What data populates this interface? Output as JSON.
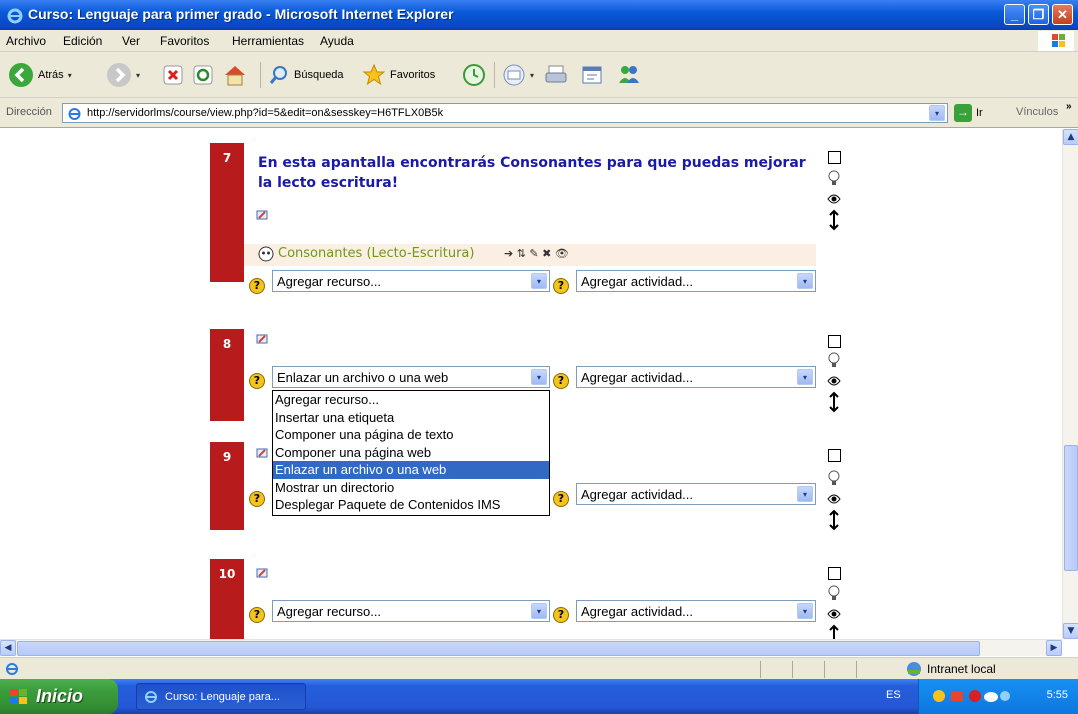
{
  "window": {
    "title": "Curso: Lenguaje para primer grado - Microsoft Internet Explorer",
    "minimize_symbol": "_",
    "restore_symbol": "❐",
    "close_symbol": "✕"
  },
  "menu": [
    "Archivo",
    "Edición",
    "Ver",
    "Favoritos",
    "Herramientas",
    "Ayuda"
  ],
  "toolbar": {
    "back_label": "Atrás",
    "search_label": "Búsqueda",
    "favorites_label": "Favoritos",
    "dropdown_symbol": "▾"
  },
  "address": {
    "label": "Dirección",
    "url": "http://servidorlms/course/view.php?id=5&edit=on&sesskey=H6TFLX0B5k",
    "go_label": "Ir",
    "go_symbol": "→",
    "links_label": "Vínculos",
    "more_symbol": "»"
  },
  "sections": [
    {
      "number": "7",
      "heading": "En esta apantalla encontrarás Consonantes para que puedas mejorar la lecto escritura!",
      "resource_link": "Consonantes (Lecto-Escritura)",
      "resource_tools": "➔ ⇅ ✎ ✖ 👁",
      "resource_select": "Agregar recurso...",
      "activity_select": "Agregar actividad..."
    },
    {
      "number": "8",
      "resource_select": "Enlazar un archivo o una web",
      "activity_select": "Agregar actividad..."
    },
    {
      "number": "9",
      "activity_select": "Agregar actividad..."
    },
    {
      "number": "10",
      "resource_select": "Agregar recurso...",
      "activity_select": "Agregar actividad..."
    }
  ],
  "dropdown_options": [
    "Agregar recurso...",
    "Insertar una etiqueta",
    "Componer una página de texto",
    "Componer una página web",
    "Enlazar un archivo o una web",
    "Mostrar un directorio",
    "Desplegar Paquete de Contenidos IMS"
  ],
  "dropdown_selected_index": 4,
  "help_symbol": "?",
  "select_arrow_symbol": "▾",
  "statusbar": {
    "zone": "Intranet local"
  },
  "taskbar": {
    "start": "Inicio",
    "task": "Curso: Lenguaje para...",
    "language": "ES",
    "clock": "5:55"
  },
  "colors": {
    "section_number_bg": "#b81b1b",
    "heading_text": "#1a1aa6",
    "resource_link": "#6a9a1a",
    "highlight": "#316ac5"
  }
}
